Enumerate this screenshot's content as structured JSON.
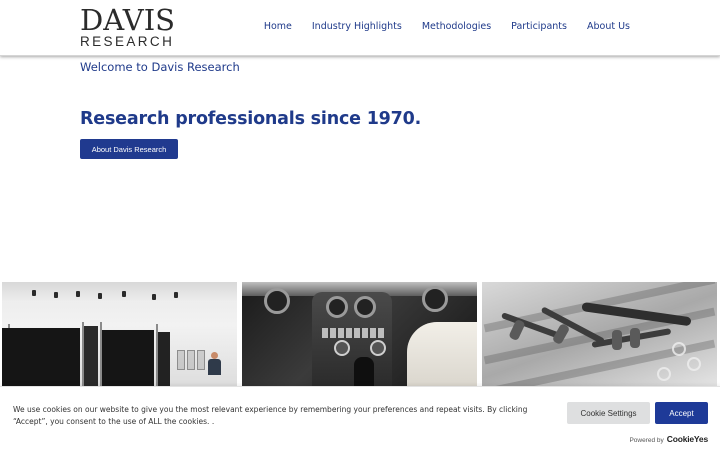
{
  "header": {
    "logo_top": "DAVIS",
    "logo_bottom": "RESEARCH",
    "nav": [
      "Home",
      "Industry Highlights",
      "Methodologies",
      "Participants",
      "About Us"
    ]
  },
  "hero": {
    "welcome": "Welcome to Davis Research",
    "title": "Research professionals since 1970.",
    "button_label": "About Davis Research"
  },
  "gallery": {
    "tiles": [
      "facility-room-photo",
      "car-interior-photo",
      "woodworking-tools-photo"
    ]
  },
  "cookie_banner": {
    "text": "We use cookies on our website to give you the most relevant experience by remembering your preferences and repeat visits. By clicking “Accept”, you consent to the use of ALL the cookies. .",
    "settings_label": "Cookie Settings",
    "accept_label": "Accept",
    "powered_by": "Powered by",
    "brand": "CookieYes"
  },
  "colors": {
    "brand_blue": "#1f3a8a",
    "button_blue": "#203a8f",
    "accept_blue": "#1e3a98",
    "settings_gray": "#dedfe0"
  }
}
